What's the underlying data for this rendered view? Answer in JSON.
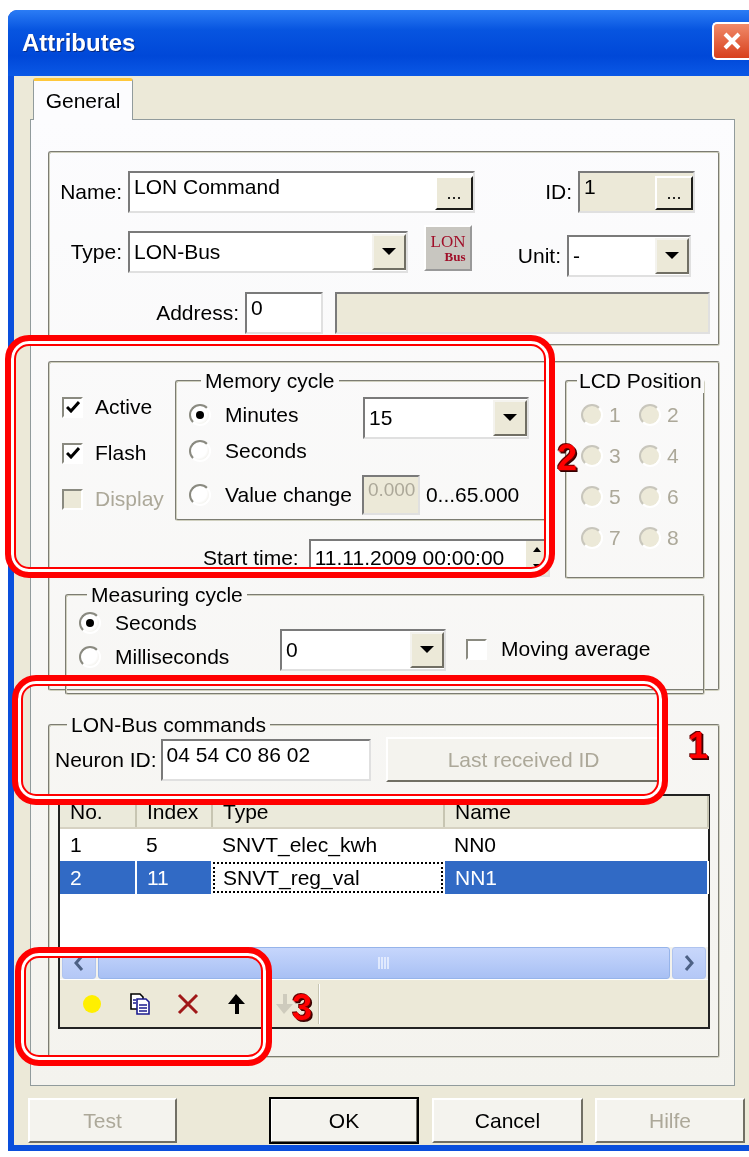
{
  "window": {
    "title": "Attributes"
  },
  "tabs": [
    {
      "label": "General",
      "selected": true
    }
  ],
  "general": {
    "name": {
      "label": "Name:",
      "value": "LON Command",
      "button": "..."
    },
    "id": {
      "label": "ID:",
      "value": "1",
      "button": "..."
    },
    "type": {
      "label": "Type:",
      "value": "LON-Bus",
      "icon_lines": [
        "LON",
        "Bus"
      ]
    },
    "unit": {
      "label": "Unit:",
      "value": "-"
    },
    "address": {
      "label": "Address:",
      "value": "0"
    }
  },
  "options": [
    {
      "label": "Active",
      "checked": true,
      "disabled": false
    },
    {
      "label": "Flash",
      "checked": true,
      "disabled": false
    },
    {
      "label": "Display",
      "checked": false,
      "disabled": true
    }
  ],
  "memory_cycle": {
    "title": "Memory cycle",
    "modes": [
      {
        "label": "Minutes",
        "selected": true
      },
      {
        "label": "Seconds",
        "selected": false
      },
      {
        "label": "Value change",
        "selected": false
      }
    ],
    "interval": "15",
    "threshold": {
      "value": "0.000",
      "disabled": true
    },
    "range": "0...65.000"
  },
  "lcd_position": {
    "title": "LCD Position",
    "disabled": true,
    "positions": [
      {
        "label": "1",
        "selected": false
      },
      {
        "label": "2",
        "selected": false
      },
      {
        "label": "3",
        "selected": false
      },
      {
        "label": "4",
        "selected": false
      },
      {
        "label": "5",
        "selected": false
      },
      {
        "label": "6",
        "selected": false
      },
      {
        "label": "7",
        "selected": false
      },
      {
        "label": "8",
        "selected": false
      }
    ]
  },
  "start_time": {
    "label": "Start time:",
    "value": "11.11.2009 00:00:00"
  },
  "measuring_cycle": {
    "title": "Measuring cycle",
    "modes": [
      {
        "label": "Seconds",
        "selected": true
      },
      {
        "label": "Milliseconds",
        "selected": false
      }
    ],
    "interval": "0",
    "moving_average": {
      "label": "Moving average",
      "checked": false
    }
  },
  "lon_commands": {
    "title": "LON-Bus commands",
    "neuron_id": {
      "label": "Neuron ID:",
      "value": "04 54 C0 86 02"
    },
    "last_received_button": {
      "label": "Last received ID",
      "disabled": true
    },
    "table": {
      "columns": [
        "No.",
        "Index",
        "Type",
        "Name"
      ],
      "rows": [
        {
          "cells": [
            "1",
            "5",
            "SNVT_elec_kwh",
            "NN0"
          ],
          "selected": false
        },
        {
          "cells": [
            "2",
            "11",
            "SNVT_reg_val",
            "NN1"
          ],
          "selected": true
        }
      ]
    },
    "toolbar": [
      {
        "kind": "new",
        "disabled": false
      },
      {
        "kind": "copy",
        "disabled": false
      },
      {
        "kind": "delete",
        "disabled": false
      },
      {
        "kind": "up",
        "disabled": false
      },
      {
        "kind": "down",
        "disabled": true
      }
    ]
  },
  "buttons": [
    {
      "label": "Test",
      "disabled": true,
      "default": false
    },
    {
      "label": "OK",
      "disabled": false,
      "default": true
    },
    {
      "label": "Cancel",
      "disabled": false,
      "default": false
    },
    {
      "label": "Hilfe",
      "disabled": true,
      "default": false
    }
  ],
  "annotations": [
    {
      "number": "1"
    },
    {
      "number": "2"
    },
    {
      "number": "3"
    }
  ]
}
